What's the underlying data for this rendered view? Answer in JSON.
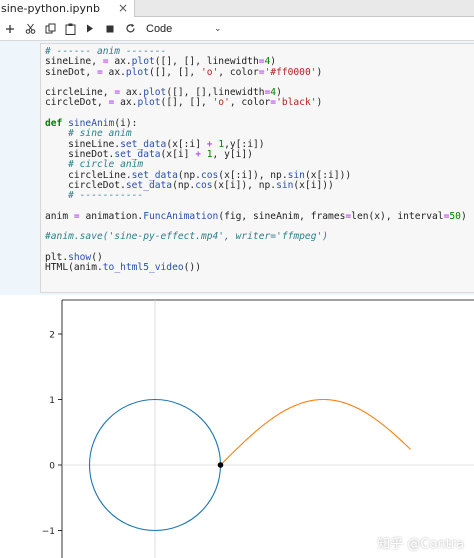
{
  "tab": {
    "title": "sine-python.ipynb",
    "close_glyph": "×"
  },
  "toolbar": {
    "buttons": [
      "add-icon",
      "cut-icon",
      "copy-icon",
      "paste-icon",
      "run-icon",
      "stop-icon",
      "restart-icon"
    ],
    "cell_type": "Code",
    "chevron": "⌄"
  },
  "code_lines": [
    "# ------ anim -------",
    "sineLine, = ax.plot([], [], linewidth=4)",
    "sineDot, = ax.plot([], [], 'o', color='#ff0000')",
    "",
    "circleLine, = ax.plot([], [],linewidth=4)",
    "circleDot, = ax.plot([], [], 'o', color='black')",
    "",
    "def sineAnim(i):",
    "    # sine anim",
    "    sineLine.set_data(x[:i] + 1,y[:i])",
    "    sineDot.set_data(x[i] + 1, y[i])",
    "    # circle anim",
    "    circleLine.set_data(np.cos(x[:i]), np.sin(x[:i]))",
    "    circleDot.set_data(np.cos(x[i]), np.sin(x[i]))",
    "    # -----------",
    "",
    "anim = animation.FuncAnimation(fig, sineAnim, frames=len(x), interval=50)",
    "",
    "#anim.save('sine-py-effect.mp4', writer='ffmpeg')",
    "",
    "plt.show()",
    "HTML(anim.to_html5_video())"
  ],
  "chart_data": {
    "type": "line",
    "ylim": [
      -2.5,
      2.5
    ],
    "xlim": [
      -2.4,
      3.9
    ],
    "yticks": [
      "2",
      "1",
      "0",
      "−1"
    ],
    "grid": "zero lines only",
    "series": [
      {
        "color": "#1f77b4",
        "shape": "unit circle centered at (0,0)"
      },
      {
        "color": "#ff7f0e",
        "points": [
          [
            1.0,
            0.0
          ],
          [
            1.5,
            0.48
          ],
          [
            2.0,
            0.84
          ],
          [
            2.57,
            1.0
          ],
          [
            3.0,
            0.91
          ],
          [
            3.5,
            0.6
          ],
          [
            3.9,
            0.24
          ]
        ]
      }
    ],
    "marker": {
      "color": "#000000",
      "x": 1.0,
      "y": 0.0
    }
  },
  "watermark": "知乎 @Contra"
}
